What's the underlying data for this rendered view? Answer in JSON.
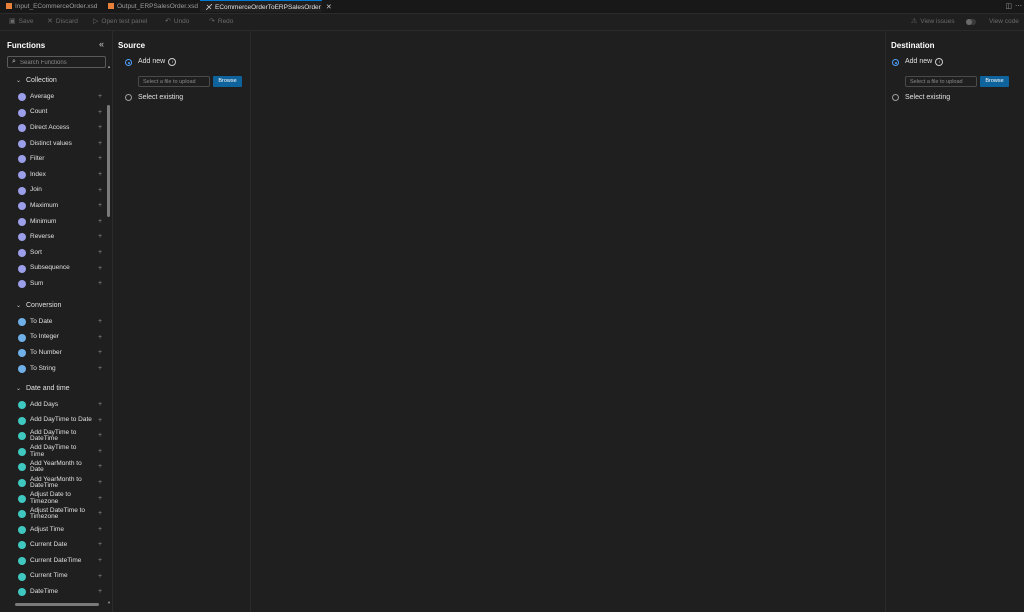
{
  "tabs": [
    {
      "label": "Input_ECommerceOrder.xsd",
      "icon": "rss-icon"
    },
    {
      "label": "Output_ERPSalesOrder.xsd",
      "icon": "rss-icon"
    },
    {
      "label": "ECommerceOrderToERPSalesOrder",
      "icon": "data-mapper-icon",
      "active": true
    }
  ],
  "toolbar": {
    "save": "Save",
    "discard": "Discard",
    "open_test_panel": "Open test panel",
    "undo": "Undo",
    "redo": "Redo",
    "view_issues": "View issues",
    "view_code": "View code"
  },
  "functions": {
    "title": "Functions",
    "search_placeholder": "Search Functions",
    "categories": [
      {
        "name": "Collection",
        "color": "#9b9ee8",
        "items": [
          "Average",
          "Count",
          "Direct Access",
          "Distinct values",
          "Filter",
          "Index",
          "Join",
          "Maximum",
          "Minimum",
          "Reverse",
          "Sort",
          "Subsequence",
          "Sum"
        ]
      },
      {
        "name": "Conversion",
        "color": "#6fb0e8",
        "items": [
          "To Date",
          "To Integer",
          "To Number",
          "To String"
        ]
      },
      {
        "name": "Date and time",
        "color": "#3fc8c0",
        "items": [
          "Add Days",
          "Add DayTime to Date",
          "Add DayTime to DateTime",
          "Add DayTime to Time",
          "Add YearMonth to Date",
          "Add YearMonth to DateTime",
          "Adjust Date to Timezone",
          "Adjust DateTime to Timezone",
          "Adjust Time",
          "Current Date",
          "Current DateTime",
          "Current Time",
          "DateTime"
        ]
      }
    ]
  },
  "source": {
    "title": "Source",
    "add_new": "Add new",
    "select_existing": "Select existing",
    "file_placeholder": "Select a file to upload",
    "browse": "Browse"
  },
  "destination": {
    "title": "Destination",
    "add_new": "Add new",
    "select_existing": "Select existing",
    "file_placeholder": "Select a file to upload",
    "browse": "Browse"
  }
}
